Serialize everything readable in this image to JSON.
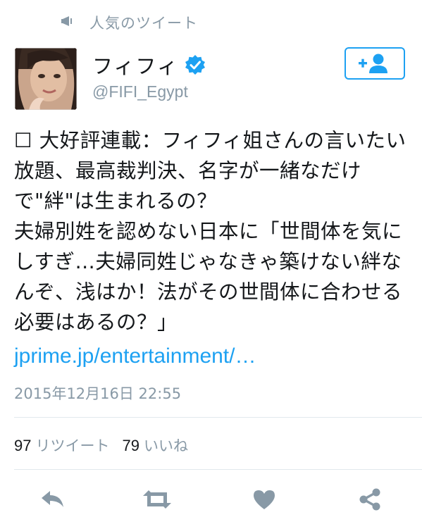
{
  "header": {
    "label": "人気のツイート",
    "icon": "pin-icon"
  },
  "user": {
    "display_name": "フィフィ",
    "handle": "@FIFI_Egypt",
    "verified": true,
    "avatar_icon": "avatar-photo"
  },
  "follow_button": {
    "icon": "add-user-icon"
  },
  "tweet": {
    "text": "☐ 大好評連載：フィフィ姐さんの言いたい放題、最高裁判決、名字が一緒なだけで\"絆\"は生まれるの？\n夫婦別姓を認めない日本に「世間体を気にしすぎ…夫婦同姓じゃなきゃ築けない絆なんぞ、浅はか！法がその世間体に合わせる必要はあるの？」",
    "link": "jprime.jp/entertainment/…",
    "timestamp": "2015年12月16日 22:55"
  },
  "stats": {
    "retweets_count": "97",
    "retweets_label": "リツイート",
    "likes_count": "79",
    "likes_label": "いいね"
  },
  "actions": [
    "reply-icon",
    "retweet-icon",
    "like-icon",
    "share-icon"
  ],
  "colors": {
    "accent": "#1da1f2",
    "muted": "#8899a6",
    "text": "#14171a",
    "icon": "#8899a6"
  }
}
